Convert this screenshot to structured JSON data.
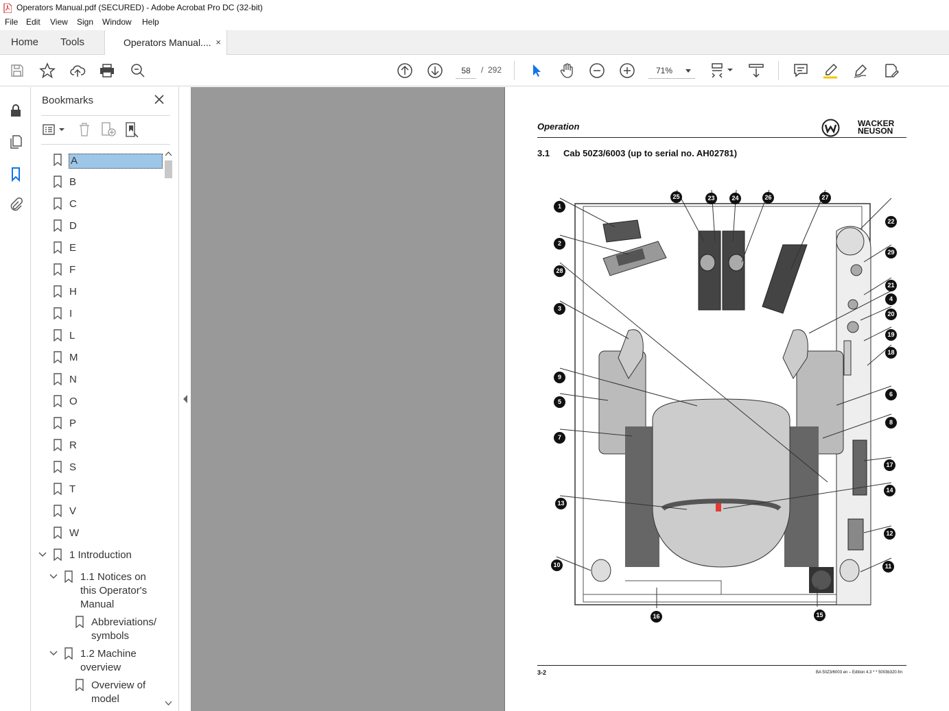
{
  "window": {
    "title": "Operators Manual.pdf (SECURED) - Adobe Acrobat Pro DC (32-bit)"
  },
  "menu": [
    "File",
    "Edit",
    "View",
    "Sign",
    "Window",
    "Help"
  ],
  "tabs": {
    "home": "Home",
    "tools": "Tools",
    "document": "Operators Manual....",
    "close": "×"
  },
  "navigation": {
    "current_page": "58",
    "separator": "/",
    "total_pages": "292",
    "zoom": "71%"
  },
  "bookmarks": {
    "title": "Bookmarks",
    "items": [
      {
        "label": "A",
        "level": 0,
        "selected": true
      },
      {
        "label": "B",
        "level": 0
      },
      {
        "label": "C",
        "level": 0
      },
      {
        "label": "D",
        "level": 0
      },
      {
        "label": "E",
        "level": 0
      },
      {
        "label": "F",
        "level": 0
      },
      {
        "label": "H",
        "level": 0
      },
      {
        "label": "I",
        "level": 0
      },
      {
        "label": "L",
        "level": 0
      },
      {
        "label": "M",
        "level": 0
      },
      {
        "label": "N",
        "level": 0
      },
      {
        "label": "O",
        "level": 0
      },
      {
        "label": "P",
        "level": 0
      },
      {
        "label": "R",
        "level": 0
      },
      {
        "label": "S",
        "level": 0
      },
      {
        "label": "T",
        "level": 0
      },
      {
        "label": "V",
        "level": 0
      },
      {
        "label": "W",
        "level": 0
      },
      {
        "label": "1 Introduction",
        "level": 0,
        "expanded": true
      },
      {
        "label": "1.1 Notices on this Operator's Manual",
        "level": 1,
        "expanded": true
      },
      {
        "label": "Abbreviations/ symbols",
        "level": 2
      },
      {
        "label": "1.2 Machine overview",
        "level": 1,
        "expanded": true
      },
      {
        "label": "Overview of model",
        "level": 2
      }
    ]
  },
  "document": {
    "section_header": "Operation",
    "logo_text_line1": "WACKER",
    "logo_text_line2": "NEUSON",
    "heading_number": "3.1",
    "heading_text": "Cab 50Z3/6003 (up to serial no. AH02781)",
    "footer_page": "3-2",
    "footer_info": "BA 50Z3/6003 en – Edition 4.3 * * 5003b320.fm",
    "callouts": [
      "1",
      "2",
      "3",
      "4",
      "5",
      "6",
      "7",
      "8",
      "9",
      "10",
      "11",
      "12",
      "13",
      "14",
      "15",
      "16",
      "17",
      "18",
      "19",
      "20",
      "21",
      "22",
      "23",
      "24",
      "25",
      "26",
      "27",
      "28",
      "29"
    ]
  },
  "colors": {
    "accent_blue": "#1473e6",
    "selected_bookmark": "#9ec6e8",
    "gutter_gray": "#999999",
    "pdf_red": "#d32f2f"
  }
}
